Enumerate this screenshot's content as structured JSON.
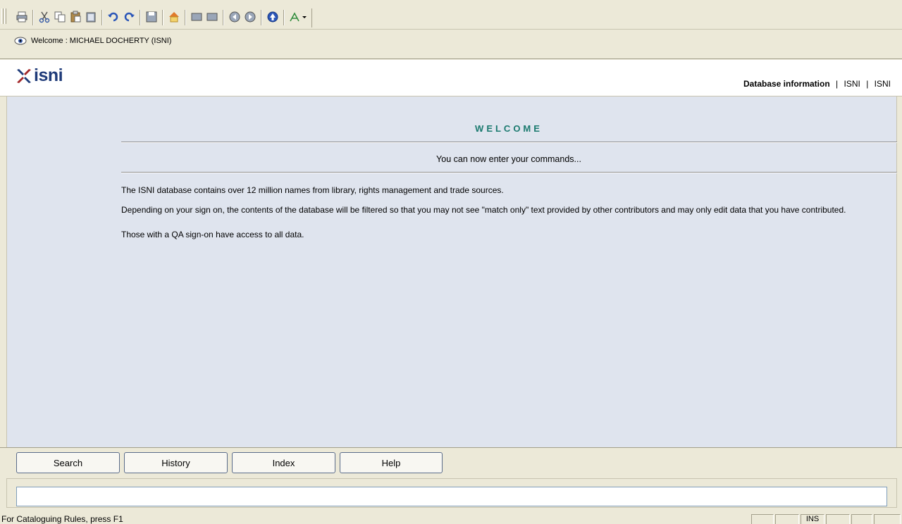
{
  "toolbar": {
    "icons": [
      "print-icon",
      "cut-icon",
      "copy-icon",
      "paste-icon",
      "clipboard-icon",
      "undo-icon",
      "redo-icon",
      "save-icon",
      "home-icon",
      "list-icon",
      "record-icon",
      "back-icon",
      "forward-icon",
      "up-icon",
      "tool-icon"
    ]
  },
  "welcome_bar": {
    "text": "Welcome : MICHAEL DOCHERTY (ISNI)"
  },
  "header": {
    "logo_text": "isni",
    "links": {
      "database_information": "Database information",
      "sep": "|",
      "isni1": "ISNI",
      "isni2": "ISNI"
    }
  },
  "main": {
    "title": "WELCOME",
    "subtitle": "You can now enter your commands...",
    "paragraph1": "The ISNI database contains over 12 million names from library, rights management and trade sources.",
    "paragraph2": "Depending on your sign on, the contents of the database will be filtered so that you may not see \"match only\" text provided by other contributors and may only edit data that you have contributed.",
    "paragraph3": "Those with a QA sign-on have access to all data."
  },
  "buttons": {
    "search": "Search",
    "history": "History",
    "index": "Index",
    "help": "Help"
  },
  "command": {
    "value": "",
    "placeholder": ""
  },
  "status": {
    "text": "For Cataloguing Rules, press F1",
    "ins": "INS"
  },
  "colors": {
    "main_bg": "#dfe4ee",
    "title": "#1b7a6f",
    "logo": "#1f3b79",
    "chrome": "#ece9d8"
  }
}
